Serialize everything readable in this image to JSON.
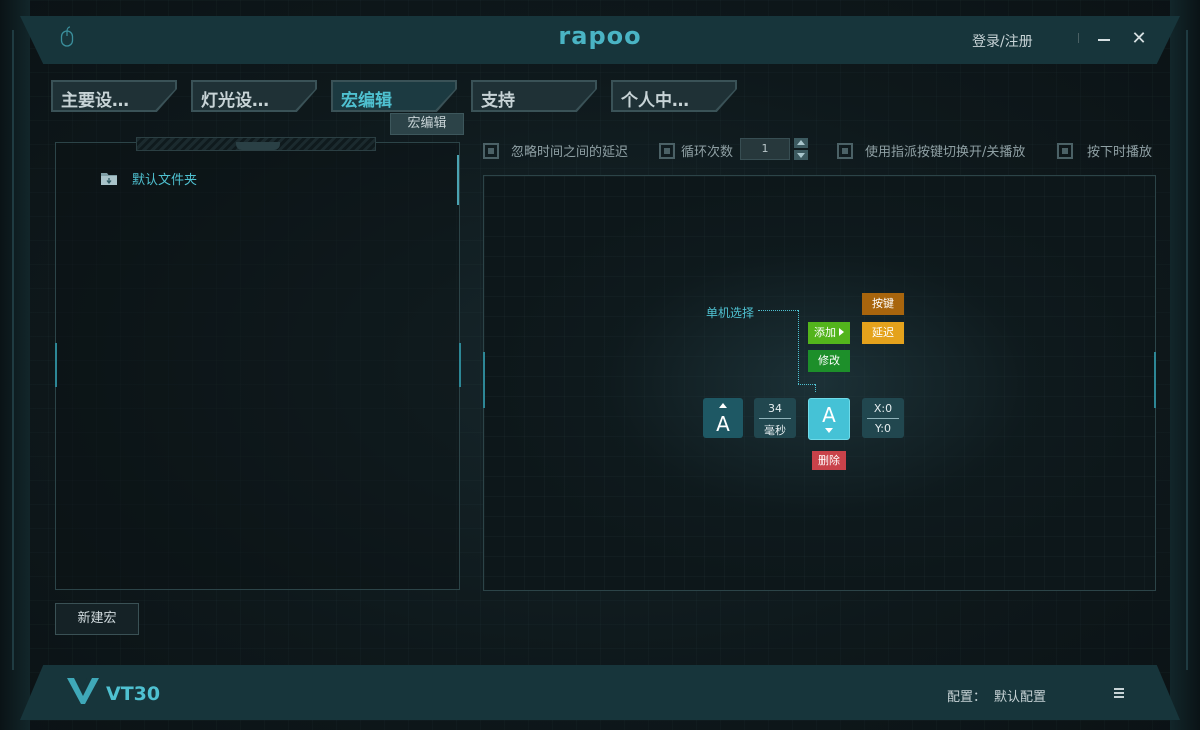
{
  "titlebar": {
    "brand": "rapoo",
    "login_label": "登录/注册",
    "icons": [
      "mouse-icon",
      "minimize-icon",
      "close-icon"
    ]
  },
  "tabs": [
    {
      "label": "主要设…",
      "active": false
    },
    {
      "label": "灯光设…",
      "active": false
    },
    {
      "label": "宏编辑",
      "active": true
    },
    {
      "label": "支持",
      "active": false
    },
    {
      "label": "个人中…",
      "active": false
    }
  ],
  "tooltip": "宏编辑",
  "macro_tree": {
    "folder_label": "默认文件夹",
    "folder_icon": "folder-icon",
    "new_macro_label": "新建宏"
  },
  "options": {
    "ignore_delay": "忽略时间之间的延迟",
    "loop_count": "循环次数",
    "loop_value": "1",
    "toggle_key": "使用指派按键切换开/关播放",
    "hold_play": "按下时播放"
  },
  "editor": {
    "single_select": "单机选择",
    "add_label": "添加",
    "modify_label": "修改",
    "key_label": "按键",
    "delay_label": "延迟",
    "delete_label": "删除",
    "nodes": {
      "key_down_letter": "A",
      "delay_value": "34",
      "delay_unit": "毫秒",
      "key_up_letter": "A",
      "pos_x": "X:0",
      "pos_y": "Y:0"
    }
  },
  "footer": {
    "model": "VT30",
    "config_label": "配置：",
    "config_value": "默认配置",
    "icons": [
      "vt-logo-icon",
      "menu-icon"
    ]
  },
  "colors": {
    "accent": "#4fc1d1",
    "add": "#53b41c",
    "modify": "#1d8f2a",
    "key": "#a8650d",
    "delay": "#e4a21c",
    "delete": "#c9424a",
    "active_node": "#45c2d6"
  }
}
